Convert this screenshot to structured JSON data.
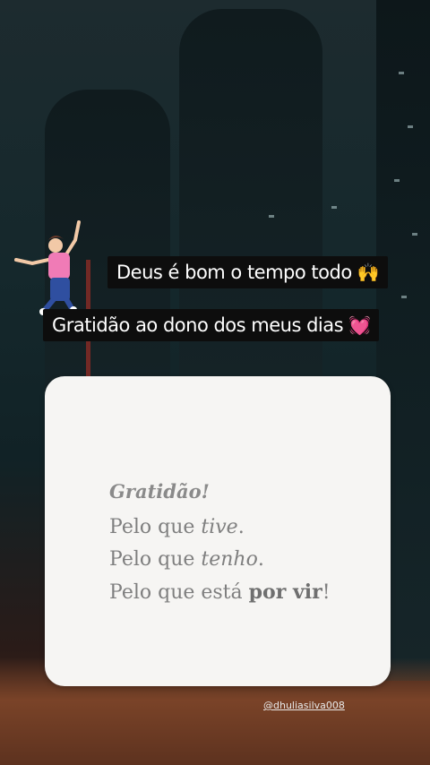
{
  "captions": {
    "line1": "Deus é bom o tempo todo",
    "line1_emoji": "🙌",
    "line2": "Gratidão ao dono dos meus dias",
    "line2_emoji": "💓"
  },
  "card": {
    "title": "Gratidão!",
    "line1_prefix": "Pelo que ",
    "line1_emph": "tive",
    "line1_suffix": ".",
    "line2_prefix": "Pelo que ",
    "line2_emph": "tenho",
    "line2_suffix": ".",
    "line3_prefix": "Pelo que está ",
    "line3_bold": "por vir",
    "line3_suffix": "!"
  },
  "footer": {
    "handle": "@dhuliasilva008"
  },
  "icons": {
    "sticker": "jumping-girl-sticker"
  },
  "colors": {
    "caption_bg": "#0d0d0d",
    "card_bg": "#f6f5f3",
    "text_gray": "#7f7f7f"
  }
}
